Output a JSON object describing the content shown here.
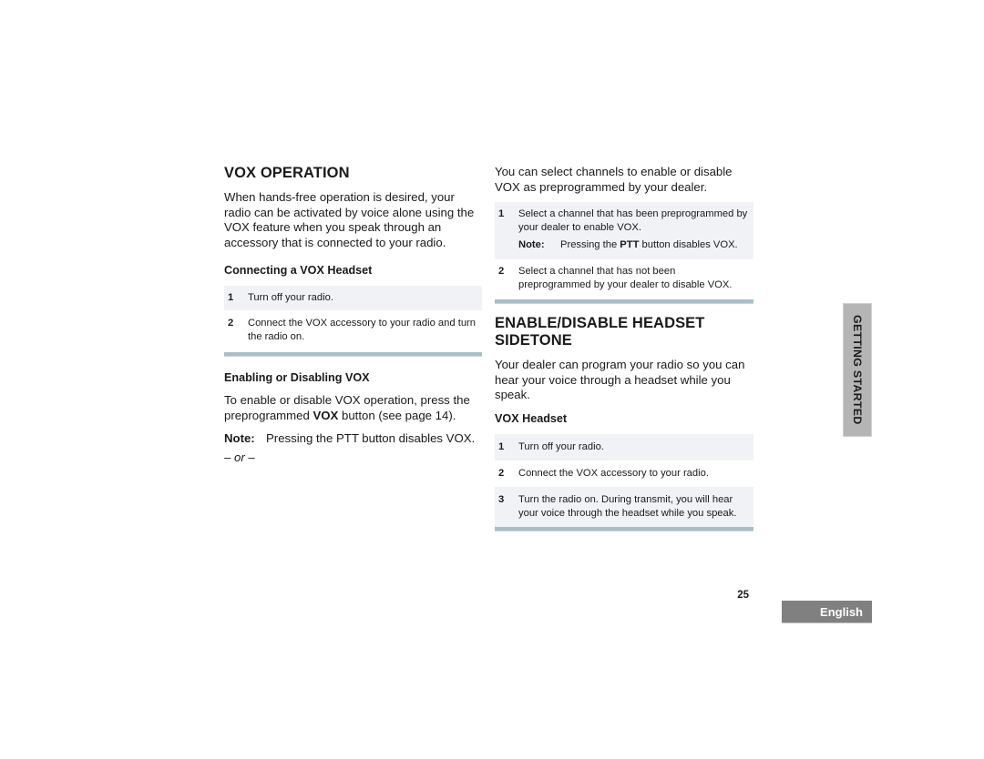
{
  "left": {
    "title": "VOX OPERATION",
    "intro": "When hands-free operation is desired, your radio can be activated by voice alone using the VOX feature when you speak through an accessory that is connected to your radio.",
    "connecting": {
      "heading": "Connecting a VOX Headset",
      "steps": [
        {
          "num": "1",
          "text": "Turn off your radio."
        },
        {
          "num": "2",
          "text": "Connect the VOX accessory to your radio and turn the radio on."
        }
      ]
    },
    "enabling": {
      "heading": "Enabling or Disabling VOX",
      "text_pre": "To enable or disable VOX operation, press the preprogrammed ",
      "text_bold": "VOX",
      "text_post": " button (see page 14).",
      "note_label": "Note:",
      "note_text": "Pressing the PTT button disables VOX.",
      "or": "– or –"
    }
  },
  "right": {
    "intro": "You can select channels to enable or disable VOX as preprogrammed by your dealer.",
    "channel_steps": [
      {
        "num": "1",
        "text": "Select a channel that has been preprogrammed by your dealer to enable VOX.",
        "note_label": "Note:",
        "note_pre": "Pressing the ",
        "note_bold": "PTT",
        "note_post": " button disables VOX."
      },
      {
        "num": "2",
        "text": "Select a channel that has not been preprogrammed by your dealer to disable VOX."
      }
    ],
    "sidetone": {
      "title": "ENABLE/DISABLE HEADSET SIDETONE",
      "intro": "Your dealer can program your radio so you can hear your voice through a headset while you speak.",
      "heading": "VOX Headset",
      "steps": [
        {
          "num": "1",
          "text": "Turn off your radio."
        },
        {
          "num": "2",
          "text": "Connect the VOX accessory to your radio."
        },
        {
          "num": "3",
          "text": "Turn the radio on. During transmit, you will hear your voice through the headset while you speak."
        }
      ]
    }
  },
  "side_tab": "GETTING STARTED",
  "page_number": "25",
  "language_tab": "English",
  "colors": {
    "rule": "#a8bfca",
    "shaded_row": "#f0f2f5",
    "side_tab": "#b5b5b5",
    "lang_tab": "#808080"
  }
}
